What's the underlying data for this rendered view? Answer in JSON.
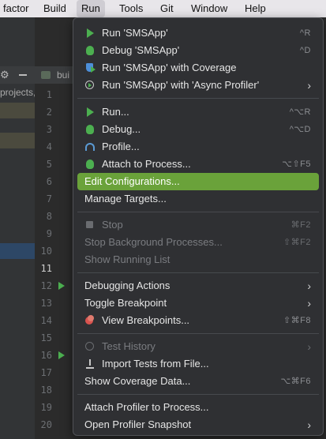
{
  "menubar": {
    "items": [
      "factor",
      "Build",
      "Run",
      "Tools",
      "Git",
      "Window",
      "Help"
    ],
    "active": "Run"
  },
  "left_panel": {
    "project_text": "projects,"
  },
  "editor": {
    "tab_text": "bui",
    "line_numbers": [
      "1",
      "2",
      "3",
      "4",
      "5",
      "6",
      "7",
      "8",
      "9",
      "10",
      "11",
      "12",
      "13",
      "14",
      "15",
      "16",
      "17",
      "18",
      "19",
      "20"
    ],
    "current_line": "11"
  },
  "menu": {
    "run_app": {
      "label": "Run 'SMSApp'",
      "shortcut": "^R"
    },
    "debug_app": {
      "label": "Debug 'SMSApp'",
      "shortcut": "^D"
    },
    "run_coverage": {
      "label": "Run 'SMSApp' with Coverage"
    },
    "run_async_profiler": {
      "label": "Run 'SMSApp' with 'Async Profiler'",
      "arrow": "›"
    },
    "run": {
      "label": "Run...",
      "shortcut": "^⌥R"
    },
    "debug": {
      "label": "Debug...",
      "shortcut": "^⌥D"
    },
    "profile": {
      "label": "Profile..."
    },
    "attach": {
      "label": "Attach to Process...",
      "shortcut": "⌥⇧F5"
    },
    "edit_config": {
      "label": "Edit Configurations..."
    },
    "manage_targets": {
      "label": "Manage Targets..."
    },
    "stop": {
      "label": "Stop",
      "shortcut": "⌘F2"
    },
    "stop_bg": {
      "label": "Stop Background Processes...",
      "shortcut": "⇧⌘F2"
    },
    "show_running": {
      "label": "Show Running List"
    },
    "debug_actions": {
      "label": "Debugging Actions",
      "arrow": "›"
    },
    "toggle_bp": {
      "label": "Toggle Breakpoint",
      "arrow": "›"
    },
    "view_bp": {
      "label": "View Breakpoints...",
      "shortcut": "⇧⌘F8"
    },
    "test_history": {
      "label": "Test History",
      "arrow": "›"
    },
    "import_tests": {
      "label": "Import Tests from File..."
    },
    "coverage_data": {
      "label": "Show Coverage Data...",
      "shortcut": "⌥⌘F6"
    },
    "attach_profiler": {
      "label": "Attach Profiler to Process..."
    },
    "open_snapshot": {
      "label": "Open Profiler Snapshot",
      "arrow": "›"
    }
  },
  "colors": {
    "selection": "#6aa23a",
    "run_green": "#4caf50",
    "menu_bg": "#2f3033"
  }
}
